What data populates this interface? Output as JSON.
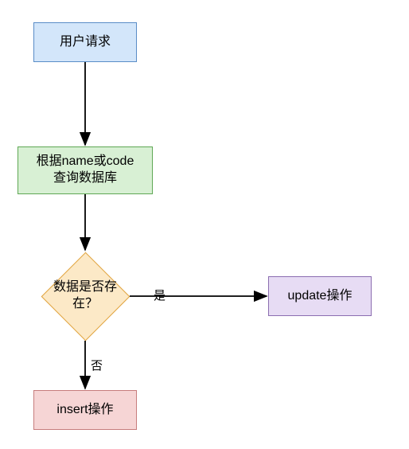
{
  "nodes": {
    "start": {
      "label": "用户请求"
    },
    "query": {
      "label": "根据name或code\n查询数据库"
    },
    "decision": {
      "label": "数据是否存\n在？"
    },
    "update": {
      "label": "update操作"
    },
    "insert": {
      "label": "insert操作"
    }
  },
  "edges": {
    "yes": {
      "label": "是"
    },
    "no": {
      "label": "否"
    }
  },
  "colors": {
    "start_fill": "#d3e6fa",
    "start_border": "#5a8dc7",
    "query_fill": "#d8f0d4",
    "query_border": "#5fa854",
    "decision_fill": "#fce9c7",
    "decision_border": "#e0a23b",
    "update_fill": "#e7dcf4",
    "update_border": "#8b6db0",
    "insert_fill": "#f6d5d5",
    "insert_border": "#c77d7d"
  },
  "chart_data": {
    "type": "flowchart",
    "nodes": [
      {
        "id": "start",
        "shape": "rect",
        "label": "用户请求"
      },
      {
        "id": "query",
        "shape": "rect",
        "label": "根据name或code查询数据库"
      },
      {
        "id": "decision",
        "shape": "diamond",
        "label": "数据是否存在？"
      },
      {
        "id": "update",
        "shape": "rect",
        "label": "update操作"
      },
      {
        "id": "insert",
        "shape": "rect",
        "label": "insert操作"
      }
    ],
    "edges": [
      {
        "from": "start",
        "to": "query",
        "label": ""
      },
      {
        "from": "query",
        "to": "decision",
        "label": ""
      },
      {
        "from": "decision",
        "to": "update",
        "label": "是"
      },
      {
        "from": "decision",
        "to": "insert",
        "label": "否"
      }
    ]
  }
}
